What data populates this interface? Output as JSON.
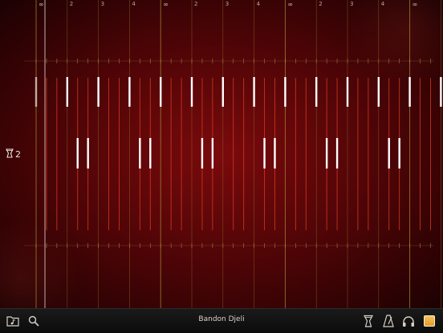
{
  "song": {
    "title": "Bandon Djeli"
  },
  "track": {
    "number": "2",
    "instrument_icon": "djembe-icon"
  },
  "timeline": {
    "loop_marker": "∞",
    "beats": [
      "∞",
      "2",
      "3",
      "4",
      "∞",
      "2",
      "3",
      "4",
      "∞",
      "2",
      "3",
      "4",
      "∞"
    ]
  },
  "pattern": {
    "bars": 4,
    "beats_per_bar": 4,
    "subdivisions_per_beat": 3,
    "row1_hits_beats": [
      0,
      1,
      2,
      3
    ],
    "row2_hits_offsets": [
      1,
      2
    ]
  },
  "toolbar": {
    "left": [
      "folder-music-icon",
      "search-icon"
    ],
    "right": [
      "djembe-icon",
      "metronome-icon",
      "headphones-icon",
      "color-swatch"
    ]
  },
  "colors": {
    "background": "#5a0608",
    "hit": "#ffffff",
    "subdivision_line": "#d83a22",
    "beat_line": "#b89a3c",
    "accent_swatch": "#f0b040"
  }
}
